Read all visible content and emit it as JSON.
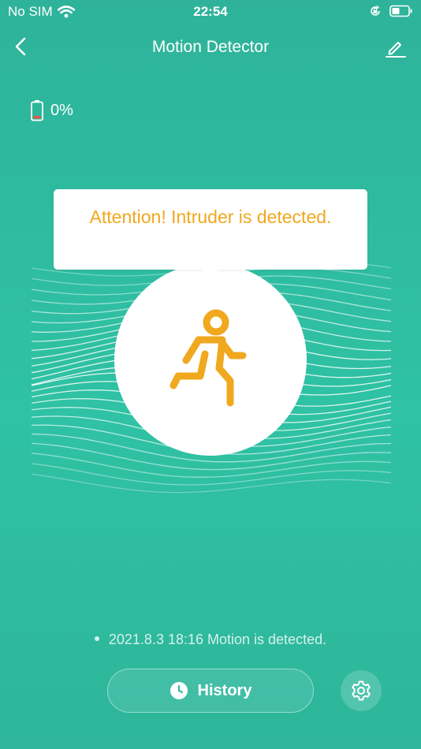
{
  "status_bar": {
    "carrier": "No SIM",
    "time": "22:54",
    "icons": [
      "wifi-icon",
      "orientation-lock-icon",
      "battery-icon"
    ]
  },
  "header": {
    "title": "Motion Detector",
    "back_icon": "chevron-left-icon",
    "edit_icon": "pencil-icon"
  },
  "device": {
    "battery_level": "0%",
    "battery_icon": "battery-low-icon"
  },
  "alert": {
    "message": "Attention! Intruder is detected.",
    "icon": "running-person-icon"
  },
  "last_event": {
    "text": "2021.8.3 18:16 Motion is detected."
  },
  "actions": {
    "history_label": "History",
    "history_icon": "clock-icon",
    "settings_icon": "gear-icon"
  },
  "colors": {
    "background": "#2fbb9f",
    "accent": "#f0a81e",
    "battery_low": "#e05a4a"
  }
}
